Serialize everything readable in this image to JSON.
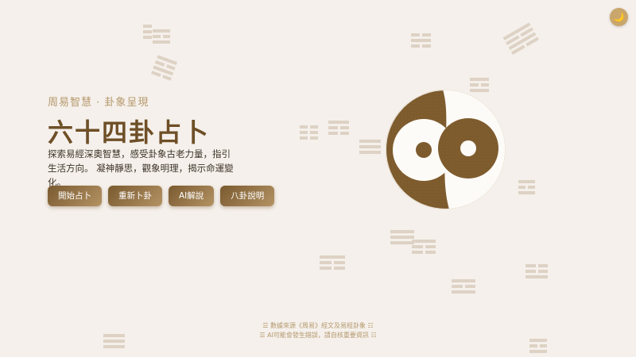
{
  "hero": {
    "subtitle": "周易智慧 · 卦象呈現",
    "title": "六十四卦占卜",
    "description": "探索易經深奧智慧，感受卦象古老力量，指引生活方向。 凝神靜思，觀象明理，揭示命運變化。"
  },
  "buttons": {
    "start": "開始占卜",
    "redo": "重新卜卦",
    "ai": "AI解說",
    "bagua": "八卦說明"
  },
  "theme_toggle": {
    "icon": "moon-icon",
    "glyph": "🌙"
  },
  "footer": {
    "line1": "☰ 數據來源《周易》經文及易經卦象 ☷",
    "line2": "☰ AI可能會發生錯誤，請自核重要資訊 ☷"
  },
  "colors": {
    "background": "#f5f0eb",
    "accent_dark": "#7a5a30",
    "accent_light": "#b39263",
    "yinyang_dark": "#7d5b2d",
    "yinyang_light": "#fdfbf7"
  }
}
